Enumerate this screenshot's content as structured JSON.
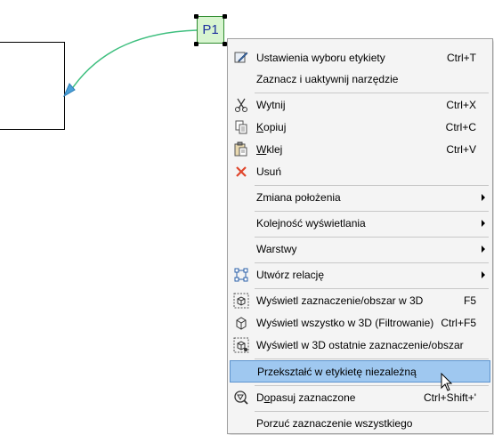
{
  "canvas": {
    "label_tag_text": "P1"
  },
  "colors": {
    "leader_line": "#3fbf7f",
    "label_fill": "#d8f5d0",
    "label_border": "#2e8b2e",
    "label_text": "#1d2f9e",
    "menu_bg": "#f4f4f4",
    "highlight": "#9fc8f0",
    "delete_icon": "#e0462c"
  },
  "menu": {
    "items": [
      {
        "label": "Ustawienia wyboru etykiety",
        "shortcut": "Ctrl+T",
        "icon": "label-settings-icon"
      },
      {
        "label": "Zaznacz i uaktywnij narzędzie",
        "shortcut": "",
        "icon": ""
      },
      {
        "label": "Wytnij",
        "shortcut": "Ctrl+X",
        "icon": "scissors-icon"
      },
      {
        "label_pre": "",
        "mnemonic": "K",
        "label_post": "opiuj",
        "shortcut": "Ctrl+C",
        "icon": "copy-icon"
      },
      {
        "label_pre": "",
        "mnemonic": "W",
        "label_post": "klej",
        "shortcut": "Ctrl+V",
        "icon": "paste-icon"
      },
      {
        "label": "Usuń",
        "shortcut": "",
        "icon": "delete-icon"
      },
      {
        "label": "Zmiana położenia",
        "submenu": true
      },
      {
        "label": "Kolejność wyświetlania",
        "submenu": true
      },
      {
        "label": "Warstwy",
        "submenu": true
      },
      {
        "label": "Utwórz relację",
        "submenu": true,
        "icon": "relation-icon"
      },
      {
        "label": "Wyświetl zaznaczenie/obszar w 3D",
        "shortcut": "F5",
        "icon": "show-selection-3d-icon"
      },
      {
        "label": "Wyświetl wszystko w 3D (Filtrowanie)",
        "shortcut": "Ctrl+F5",
        "icon": "show-all-3d-icon"
      },
      {
        "label": "Wyświetl w 3D ostatnie zaznaczenie/obszar",
        "shortcut": "",
        "icon": "show-last-3d-icon"
      },
      {
        "label": "Przekształć w etykietę niezależną",
        "shortcut": "",
        "highlighted": true
      },
      {
        "label_pre": "D",
        "mnemonic": "o",
        "label_post": "pasuj zaznaczone",
        "shortcut": "Ctrl+Shift+'",
        "icon": "fit-selection-icon"
      },
      {
        "label": "Porzuć zaznaczenie wszystkiego",
        "shortcut": ""
      }
    ]
  }
}
